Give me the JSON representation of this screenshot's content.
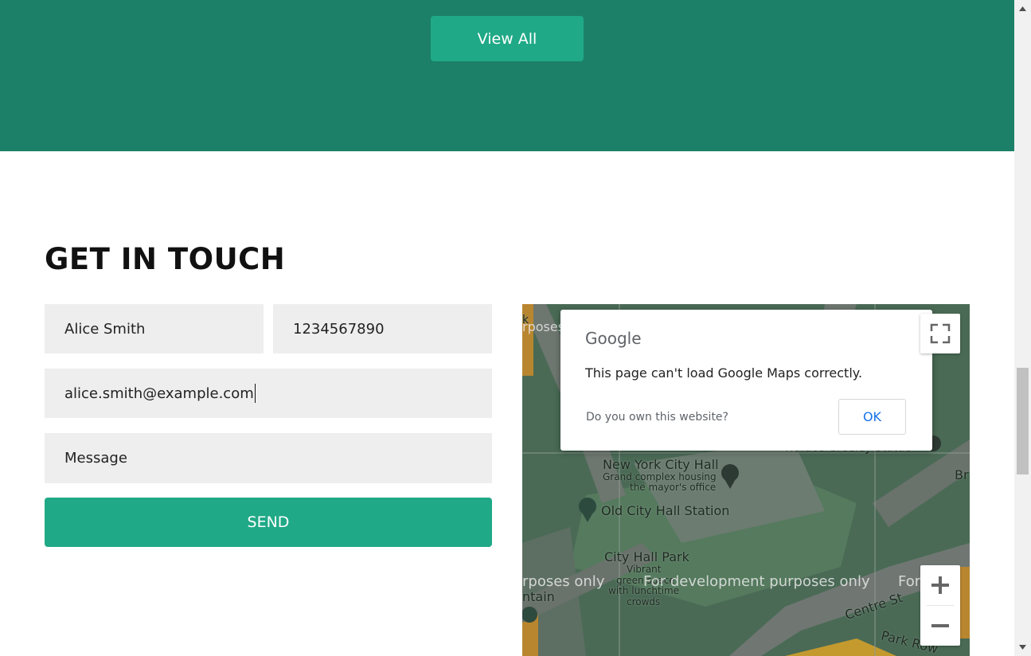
{
  "top": {
    "view_all_label": "View All"
  },
  "contact": {
    "title": "GET IN TOUCH",
    "name_value": "Alice Smith",
    "phone_value": "1234567890",
    "email_value": "alice.smith@example.com",
    "message_placeholder": "Message",
    "send_label": "SEND"
  },
  "map": {
    "dialog": {
      "logo": "Google",
      "message": "This page can't load Google Maps correctly.",
      "own_site": "Do you own this website?",
      "ok_label": "OK"
    },
    "labels": {
      "city_hall": "New York City Hall",
      "city_hall_desc_1": "Grand complex housing",
      "city_hall_desc_2": "the mayor's office",
      "station": "Old City Hall Station",
      "park": "City Hall Park",
      "park_desc_1": "Vibrant",
      "park_desc_2": "green space",
      "park_desc_3": "with lunchtime",
      "park_desc_4": "crowds",
      "centre_st": "Centre St",
      "park_row": "Park Row",
      "horace": "Horace Greeley Statue",
      "br": "Br",
      "ntain": "ntain",
      "k": "k"
    },
    "watermark_left": "rposes only",
    "watermark_mid": "For development purposes only",
    "watermark_right": "For",
    "watermark_top": "rposes",
    "zoom_in_icon": "plus-icon",
    "zoom_out_icon": "minus-icon",
    "fullscreen_icon": "fullscreen-icon"
  }
}
